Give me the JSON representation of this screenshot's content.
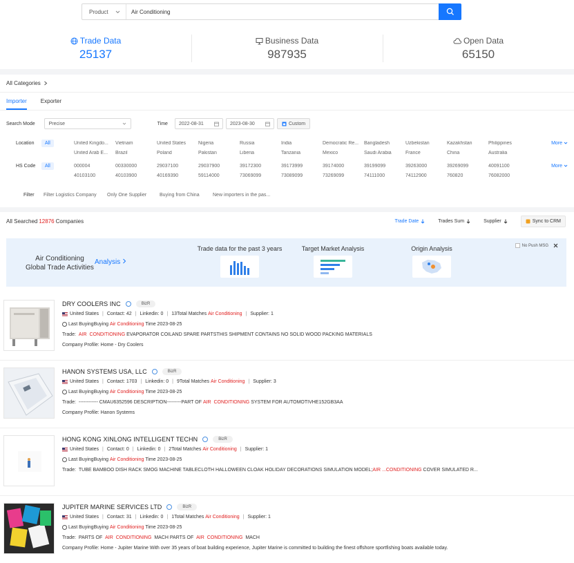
{
  "search": {
    "type": "Product",
    "query": "Air Conditioning"
  },
  "stats": [
    {
      "title": "Trade Data",
      "value": "25137",
      "icon": "globe-icon"
    },
    {
      "title": "Business Data",
      "value": "987935",
      "icon": "monitor-icon"
    },
    {
      "title": "Open Data",
      "value": "65150",
      "icon": "cloud-icon"
    }
  ],
  "categories": "All Categories",
  "tabs": [
    "Importer",
    "Exporter"
  ],
  "filters": {
    "search_mode_label": "Search Mode",
    "search_mode_value": "Precise",
    "time_label": "Time",
    "date_from": "2022-08-31",
    "date_to": "2023-08-30",
    "custom_label": "Custom",
    "location_label": "Location",
    "all_label": "All",
    "location_row1": [
      "United Kingdo...",
      "Vietnam",
      "United States",
      "Nigeria",
      "Russia",
      "India",
      "Democratic Re...",
      "Bangladesh",
      "Uzbekistan",
      "Kazakhstan",
      "Philippines"
    ],
    "location_row2": [
      "United Arab E...",
      "Brazil",
      "Poland",
      "Pakistan",
      "Liberia",
      "Tanzania",
      "Mexico",
      "Saudi Arabia",
      "France",
      "China",
      "Australia"
    ],
    "hs_label": "HS Code",
    "hs_row1": [
      "000004",
      "00330000",
      "29037100",
      "29037900",
      "39172300",
      "39173999",
      "39174000",
      "39199099",
      "39263000",
      "39269099",
      "40091100"
    ],
    "hs_row2": [
      "40103100",
      "40103900",
      "40169390",
      "59114000",
      "73069099",
      "73089099",
      "73269099",
      "74111000",
      "74112900",
      "760820",
      "76082000"
    ],
    "more_label": "More",
    "filter_label": "Filter",
    "filter_options": [
      "Filter Logistics Company",
      "Only One Supplier",
      "Buying from China",
      "New importers in the pas..."
    ]
  },
  "results": {
    "prefix": "All Searched",
    "count": "12876",
    "suffix": "Companies",
    "sort": [
      "Trade Date",
      "Trades Sum",
      "Supplier"
    ],
    "sync_label": "Sync to CRM"
  },
  "banner": {
    "title_line1": "Air Conditioning",
    "title_line2": "Global Trade Activities",
    "analysis_link": "Analysis",
    "promo1": "Trade data for the past 3 years",
    "promo2": "Target Market Analysis",
    "promo3": "Origin Analysis",
    "no_push": "No Push MSG"
  },
  "companies": [
    {
      "name": "DRY COOLERS INC",
      "bizr": "BizR",
      "country": "United States",
      "contact": "Contact: 42",
      "linkedin": "Linkedin: 0",
      "matches_prefix": "13Total Matches",
      "matches_keyword": "Air Conditioning",
      "supplier": "Supplier: 1",
      "last_prefix": "Last BuyingBuying",
      "last_keyword": "Air Conditioning",
      "last_suffix": "Time 2023-08-25",
      "trade_label": "Trade:",
      "trade_kw1": "AIR",
      "trade_kw2": "CONDITIONING",
      "trade_rest": "EVAPORATOR COILAND SPARE PARTSTHIS SHIPMENT CONTAINS NO SOLID WOOD PACKING MATERIALS",
      "profile": "Company Profile:  Home - Dry Coolers"
    },
    {
      "name": "HANON SYSTEMS USA, LLC",
      "bizr": "BizR",
      "country": "United States",
      "contact": "Contact: 1703",
      "linkedin": "Linkedin: 0",
      "matches_prefix": "9Total Matches",
      "matches_keyword": "Air Conditioning",
      "supplier": "Supplier: 3",
      "last_prefix": "Last BuyingBuying",
      "last_keyword": "Air Conditioning",
      "last_suffix": "Time 2023-08-25",
      "trade_label": "Trade:",
      "trade_pre": "------------ CMAU6352596 DESCRIPTION---------PART OF",
      "trade_kw1": "AIR",
      "trade_kw2": "CONDITIONING",
      "trade_rest": "SYSTEM FOR AUTOMOTIVHE152GB3AA",
      "profile": "Company Profile:  Hanon Systems"
    },
    {
      "name": "HONG KONG XINLONG INTELLIGENT TECHN",
      "bizr": "BizR",
      "country": "United States",
      "contact": "Contact: 0",
      "linkedin": "Linkedin: 0",
      "matches_prefix": "2Total Matches",
      "matches_keyword": "Air Conditioning",
      "supplier": "Supplier: 1",
      "last_prefix": "Last BuyingBuying",
      "last_keyword": "Air Conditioning",
      "last_suffix": "Time 2023-08-25",
      "trade_label": "Trade:",
      "trade_pre": "TUBE BAMBOO DISH RACK SMOG MACHINE TABLECLOTH HALLOWEEN CLOAK HOLIDAY DECORATIONS SIMULATION MODEL;",
      "trade_kw1": "AIR ...",
      "trade_kw2": "CONDITIONING",
      "trade_rest": "COVER SIMULATED R...",
      "profile": ""
    },
    {
      "name": "JUPITER MARINE SERVICES LTD",
      "bizr": "BizR",
      "country": "United States",
      "contact": "Contact: 31",
      "linkedin": "Linkedin: 0",
      "matches_prefix": "1Total Matches",
      "matches_keyword": "Air Conditioning",
      "supplier": "Supplier: 1",
      "last_prefix": "Last BuyingBuying",
      "last_keyword": "Air Conditioning",
      "last_suffix": "Time 2023-08-25",
      "trade_label": "Trade:",
      "trade_pre": "PARTS OF",
      "trade_kw1": "AIR",
      "trade_kw2": "CONDITIONING",
      "trade_mid": "MACH PARTS OF",
      "trade_kw3": "AIR",
      "trade_kw4": "CONDITIONING",
      "trade_rest": "MACH",
      "profile": "Company Profile:  Home - Jupiter Marine With over 35 years of boat building experience, Jupiter Marine is committed to building the finest offshore sportfishing boats available today."
    }
  ]
}
